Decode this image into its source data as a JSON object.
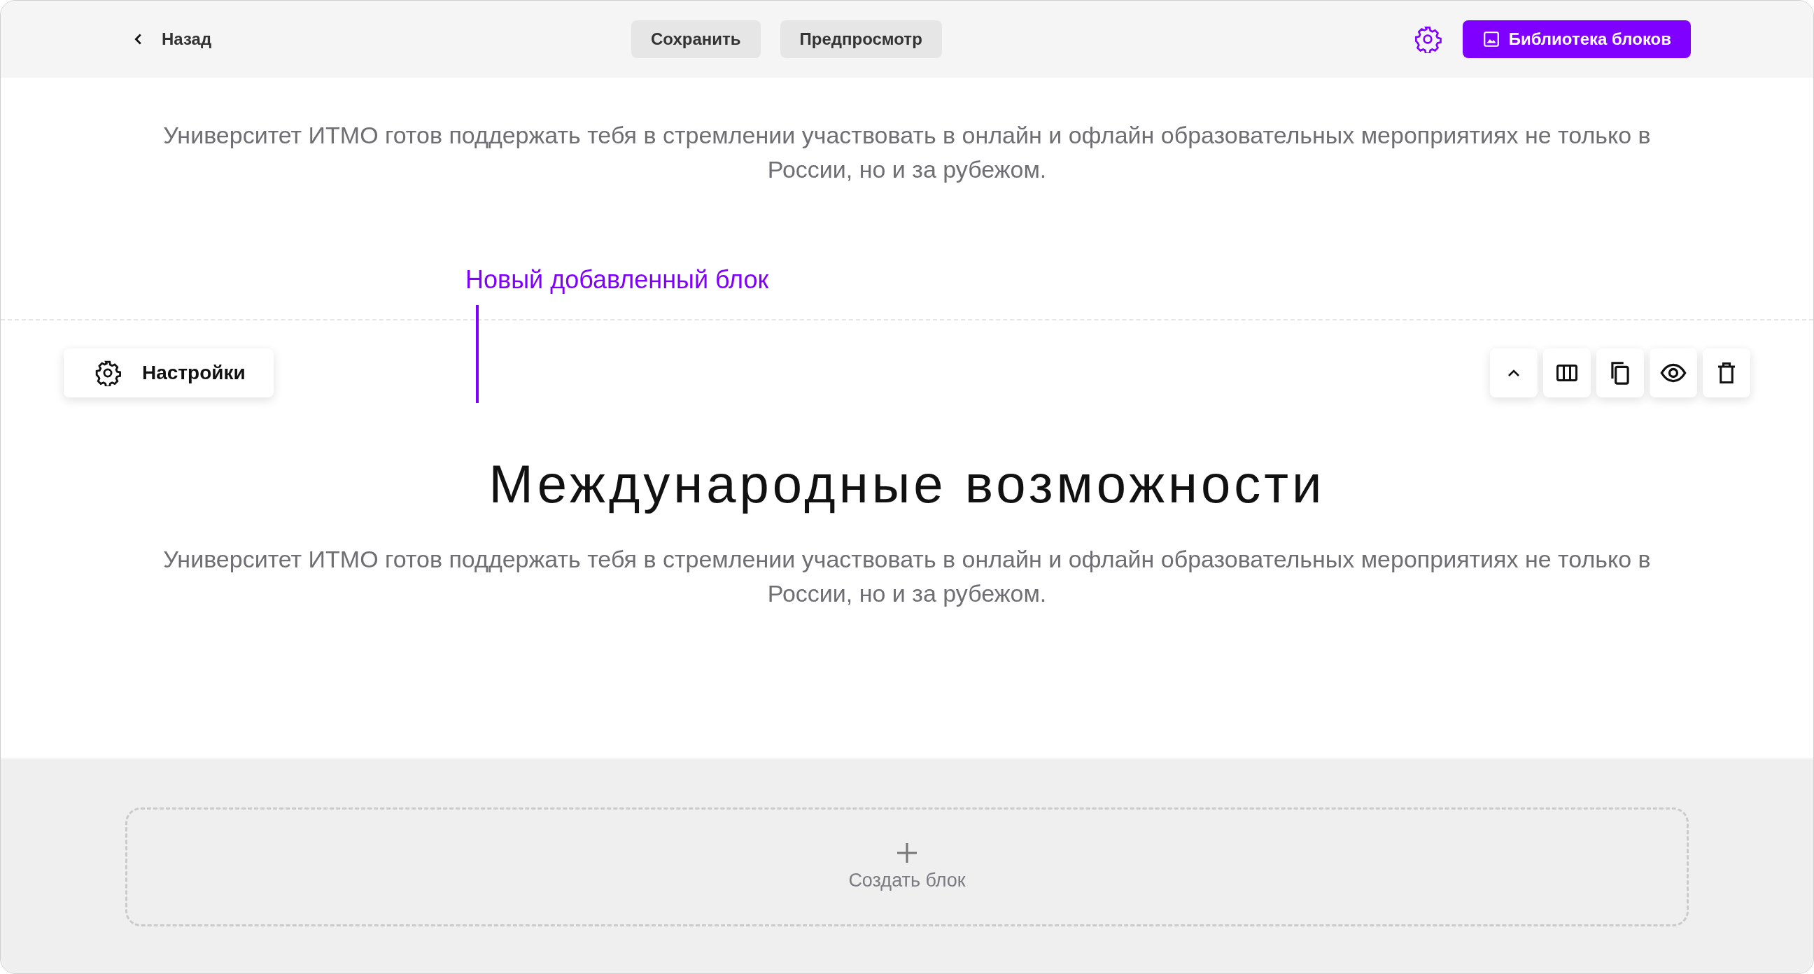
{
  "header": {
    "back": "Назад",
    "buttons": [
      "Сохранить",
      "Предпросмотр"
    ],
    "library_button": "Библиотека блоков"
  },
  "blocks": [
    {
      "kind": "text",
      "text": "Университет ИТМО готов поддержать тебя в стремлении участвовать в онлайн и офлайн образовательных мероприятиях не только в России, но и за рубежом."
    },
    {
      "kind": "new",
      "annotation": "Новый добавленный блок",
      "settings": "Настройки",
      "title": "Международные возможности",
      "text": "Университет ИТМО готов поддержать тебя в стремлении участвовать в онлайн и офлайн образовательных мероприятиях не только в России, но и за рубежом."
    }
  ],
  "create_block": "Создать блок"
}
